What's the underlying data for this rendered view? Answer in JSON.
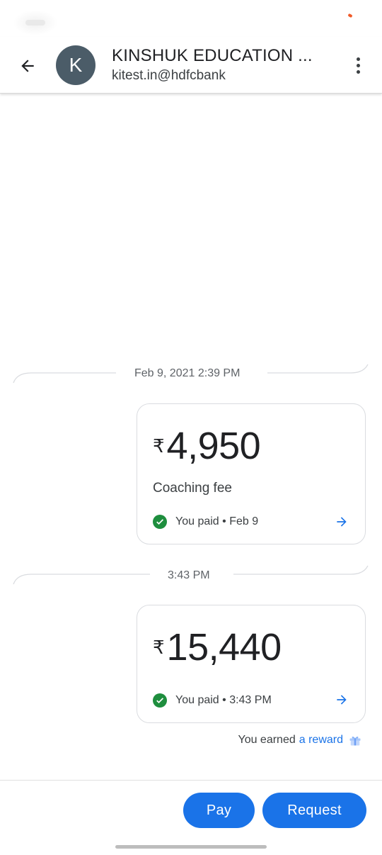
{
  "header": {
    "avatar_initial": "K",
    "contact_name": "KINSHUK EDUCATION ...",
    "contact_upi": "kitest.in@hdfcbank"
  },
  "transactions": [
    {
      "divider_label": "Feb 9, 2021 2:39 PM",
      "currency_symbol": "₹",
      "amount": "4,950",
      "note": "Coaching fee",
      "status": "You paid • Feb 9"
    },
    {
      "divider_label": "3:43 PM",
      "currency_symbol": "₹",
      "amount": "15,440",
      "status": "You paid • 3:43 PM"
    }
  ],
  "reward": {
    "prefix": "You earned",
    "link_text": "a reward"
  },
  "actions": {
    "pay_label": "Pay",
    "request_label": "Request"
  },
  "colors": {
    "accent": "#1a73e8",
    "success": "#1e8e3e",
    "avatar_bg": "#4b5c68"
  },
  "icons": [
    "back-arrow-icon",
    "more-vert-icon",
    "check-circle-icon",
    "arrow-right-icon",
    "gift-icon"
  ]
}
